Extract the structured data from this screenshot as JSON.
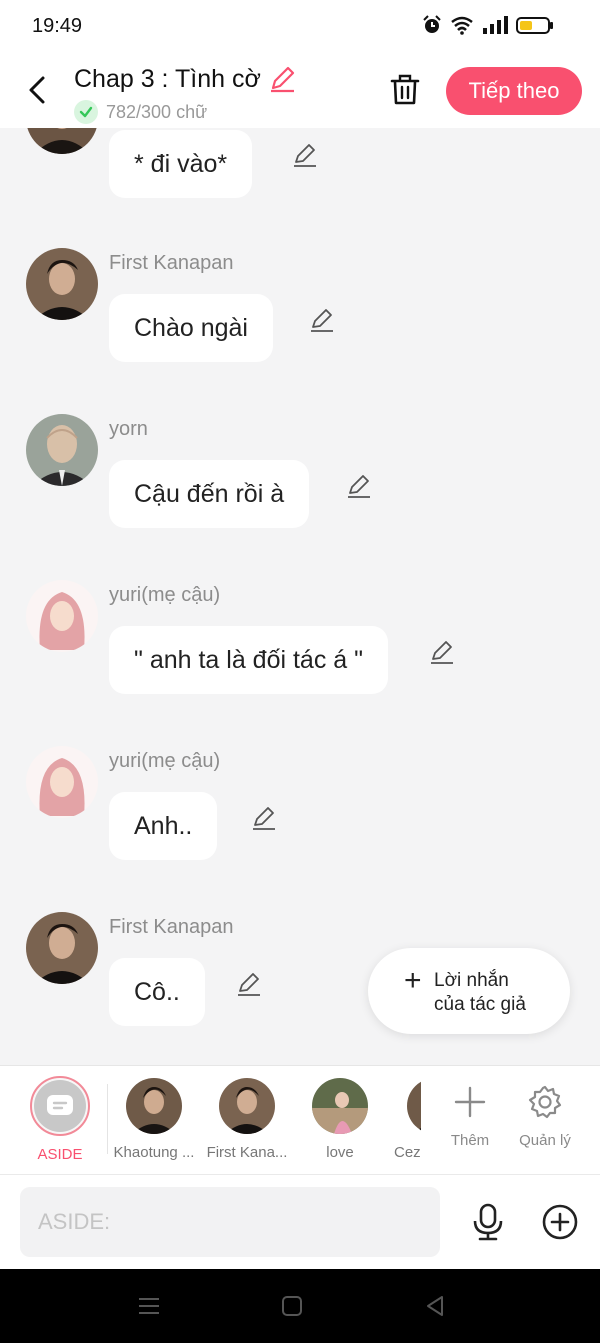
{
  "status_bar": {
    "time": "19:49",
    "icons": [
      "alarm-icon",
      "wifi-icon",
      "signal-icon",
      "battery-icon"
    ]
  },
  "header": {
    "title": "Chap 3 : Tình cờ",
    "word_count": "782/300 chữ",
    "next_button": "Tiếp theo"
  },
  "messages": [
    {
      "sender": "",
      "text": "* đi vào*",
      "avatar": "portrait-dark-man"
    },
    {
      "sender": "First Kanapan",
      "text": "Chào ngài",
      "avatar": "portrait-dark-man"
    },
    {
      "sender": "yorn",
      "text": "Cậu đến rồi à",
      "avatar": "portrait-bald-man"
    },
    {
      "sender": "yuri(mẹ cậu)",
      "text": "\" anh ta là đối tác á \"",
      "avatar": "portrait-pink-hair-woman"
    },
    {
      "sender": "yuri(mẹ cậu)",
      "text": "Anh..",
      "avatar": "portrait-pink-hair-woman"
    },
    {
      "sender": "First Kanapan",
      "text": "Cô..",
      "avatar": "portrait-dark-man"
    }
  ],
  "author_note_button": {
    "line1": "Lời nhắn",
    "line2": "của tác giả"
  },
  "character_bar": {
    "aside_label": "ASIDE",
    "characters": [
      {
        "label": "Khaotung ...",
        "avatar": "portrait-dark-man"
      },
      {
        "label": "First Kana...",
        "avatar": "portrait-dark-man"
      },
      {
        "label": "love",
        "avatar": "photo-woman-outdoor"
      },
      {
        "label": "Cez",
        "avatar": "portrait-dark-man"
      }
    ],
    "more_label": "Thêm",
    "manage_label": "Quản lý"
  },
  "input": {
    "placeholder": "ASIDE:"
  },
  "colors": {
    "accent": "#f9506f",
    "background": "#f4f4f5",
    "bubble": "#ffffff",
    "check_green": "#35c759"
  }
}
